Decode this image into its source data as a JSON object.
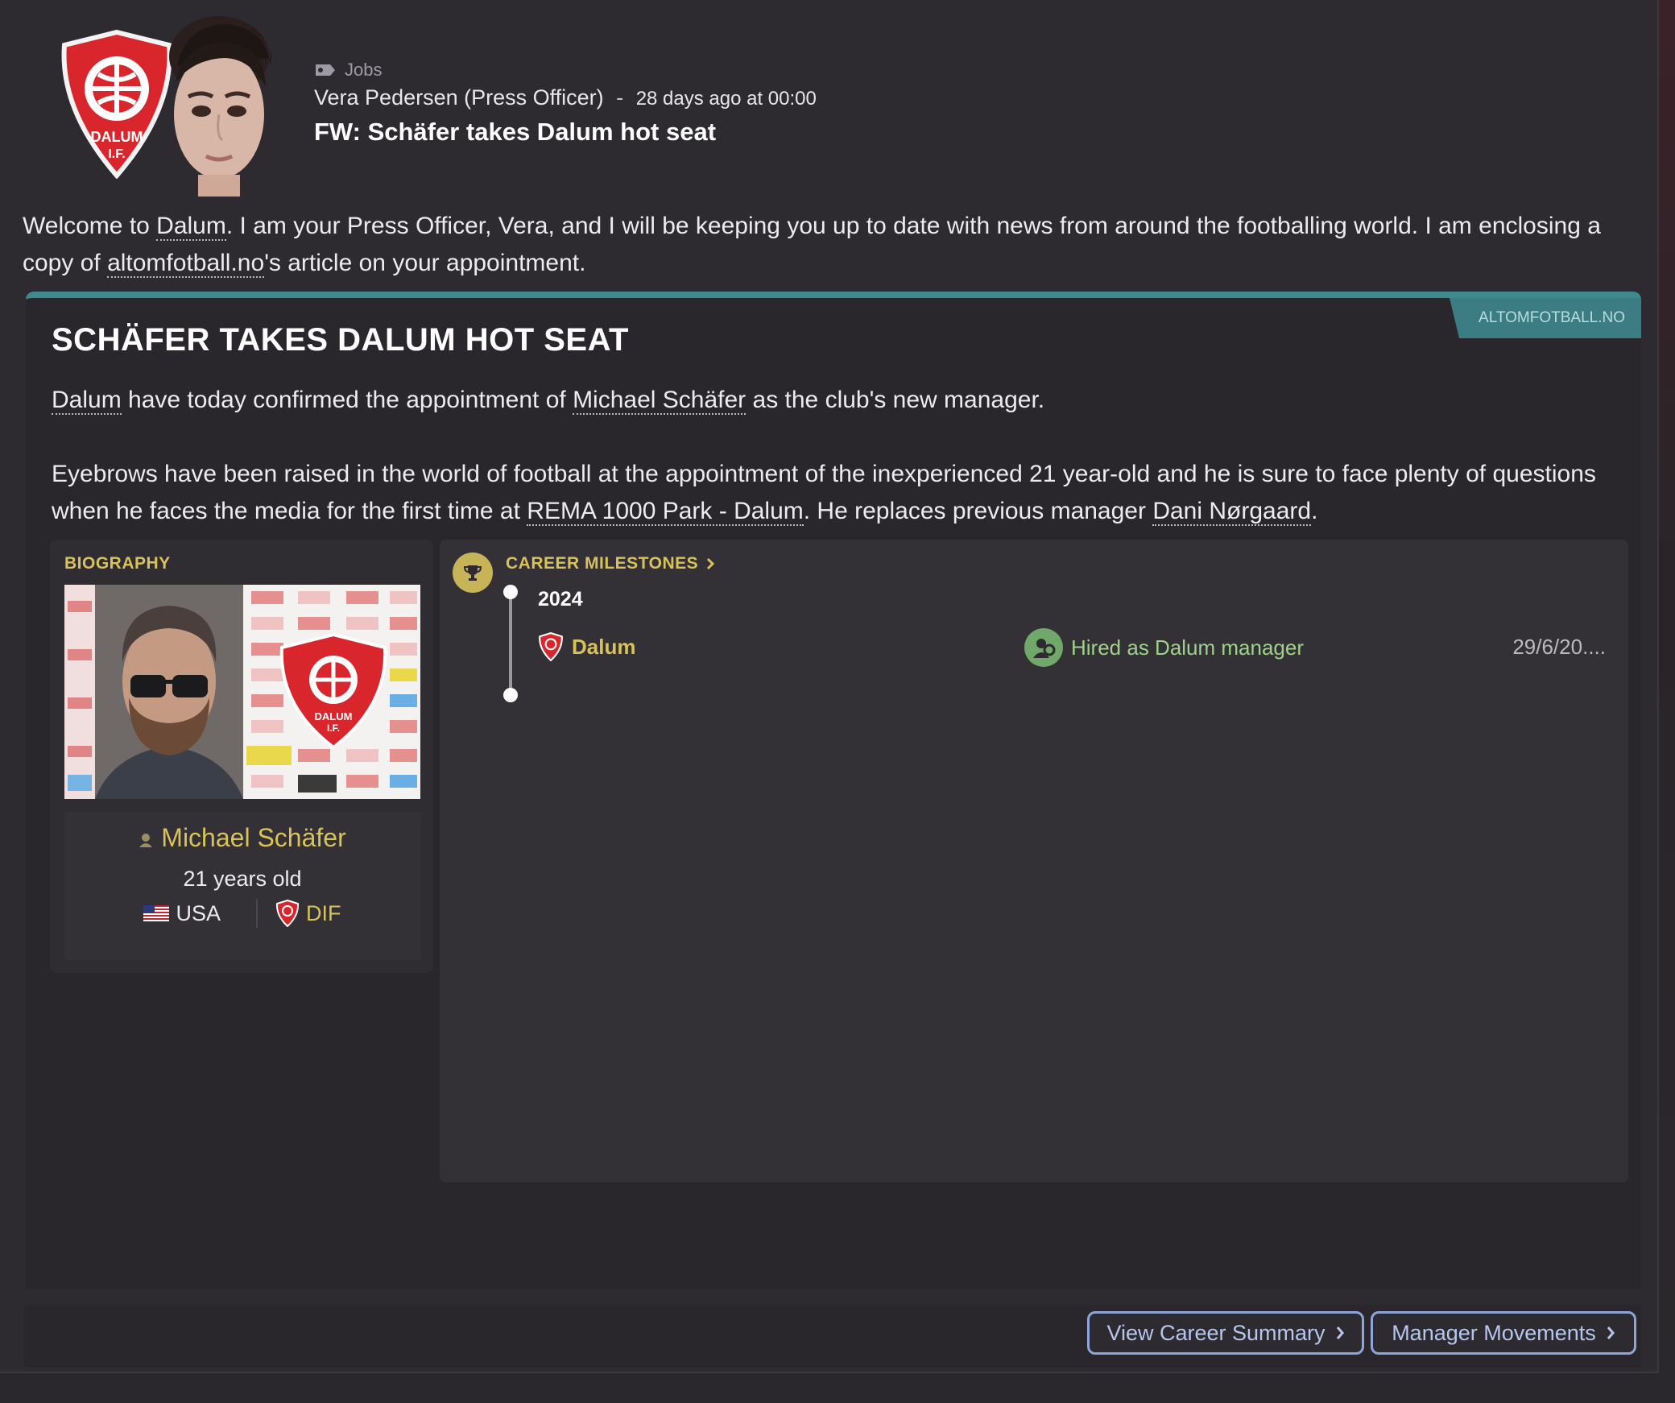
{
  "header": {
    "category": "Jobs",
    "sender": "Vera Pedersen (Press Officer)",
    "separator": "-",
    "time": "28 days ago at 00:00",
    "subject": "FW: Schäfer takes Dalum hot seat"
  },
  "intro": {
    "part1": "Welcome to ",
    "club_link": "Dalum",
    "part2": ". I am your Press Officer, Vera, and I will be keeping you up to date with news from around the footballing world. I am enclosing a copy of ",
    "source_link": "altomfotball.no",
    "part3": "'s article on your appointment."
  },
  "article": {
    "source": "ALTOMFOTBALL.NO",
    "headline": "SCHÄFER TAKES DALUM HOT SEAT",
    "p1": {
      "club": "Dalum",
      "t1": " have today confirmed the appointment of ",
      "manager": "Michael Schäfer",
      "t2": " as the club's new manager."
    },
    "p2": {
      "t1": "Eyebrows have been raised in the world of football at the appointment of the inexperienced 21 year-old and he is sure to face plenty of questions when he faces the media for the first time at ",
      "stadium": "REMA 1000 Park - Dalum",
      "t2": ". He replaces previous manager ",
      "prev_manager": "Dani Nørgaard",
      "t3": "."
    }
  },
  "biography": {
    "title": "BIOGRAPHY",
    "name": "Michael Schäfer",
    "age": "21 years old",
    "nationality": "USA",
    "club_abbr": "DIF"
  },
  "career": {
    "title": "CAREER MILESTONES",
    "year": "2024",
    "club": "Dalum",
    "event": "Hired as Dalum manager",
    "date": "29/6/20...."
  },
  "buttons": {
    "career_summary": "View Career Summary",
    "manager_movements": "Manager Movements"
  },
  "colors": {
    "accent_gold": "#d8c35a",
    "accent_teal": "#3f8a8f",
    "button_border": "#8da5d8",
    "event_green": "#9fd28a",
    "club_red": "#d8262c"
  }
}
